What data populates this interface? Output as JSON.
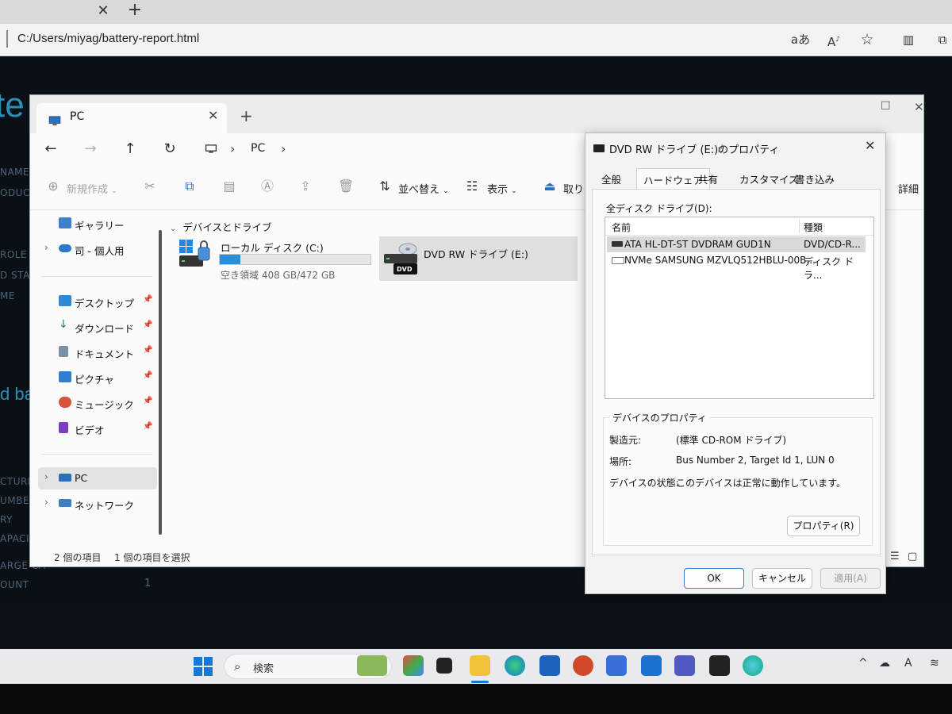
{
  "browser": {
    "address": "C:/Users/miyag/battery-report.html",
    "tools": [
      "aあ",
      "Aᴀ",
      "☆",
      "▥",
      "⧉"
    ]
  },
  "background_report": {
    "title_fragment": "te",
    "labels": [
      "NAME",
      "ODUCT",
      "ROLE",
      "D STAN",
      "ME"
    ],
    "heading_fragment": "d bat",
    "lower_labels": [
      "CTURER",
      "UMBER",
      "RY",
      "APACITY",
      "ARGE CA",
      "OUNT"
    ],
    "count_value": "1"
  },
  "explorer": {
    "tab_title": "PC",
    "address_crumb": "PC",
    "commands": {
      "new": "新規作成",
      "sort": "並べ替え",
      "view": "表示",
      "eject": "取り出",
      "details": "詳細"
    },
    "sidebar": {
      "gallery": "ギャラリー",
      "onedrive": "司 - 個人用",
      "desktop": "デスクトップ",
      "downloads": "ダウンロード",
      "documents": "ドキュメント",
      "pictures": "ピクチャ",
      "music": "ミュージック",
      "videos": "ビデオ",
      "pc": "PC",
      "network": "ネットワーク"
    },
    "section_title": "デバイスとドライブ",
    "drives": {
      "c_name": "ローカル ディスク (C:)",
      "c_space": "空き領域 408 GB/472 GB",
      "c_used_fraction": 0.136,
      "e_name": "DVD RW ドライブ (E:)",
      "e_badge": "DVD"
    },
    "status": {
      "items": "2 個の項目",
      "selected": "1 個の項目を選択"
    }
  },
  "dialog": {
    "title": "DVD RW ドライブ (E:)のプロパティ",
    "tabs": [
      "全般",
      "ハードウェア",
      "共有",
      "カスタマイズ",
      "書き込み"
    ],
    "active_tab": "ハードウェア",
    "list_label": "全ディスク ドライブ(D):",
    "columns": [
      "名前",
      "種類"
    ],
    "rows": [
      {
        "name": "ATA HL-DT-ST DVDRAM GUD1N",
        "type": "DVD/CD-R..."
      },
      {
        "name": "NVMe SAMSUNG MZVLQ512HBLU-00B...",
        "type": "ディスク ドラ..."
      }
    ],
    "group_title": "デバイスのプロパティ",
    "props": [
      {
        "key": "製造元:",
        "value": "(標準 CD-ROM ドライブ)"
      },
      {
        "key": "場所:",
        "value": "Bus Number 2, Target Id 1, LUN 0"
      },
      {
        "key": "デバイスの状態:",
        "value": "このデバイスは正常に動作しています。"
      }
    ],
    "properties_button": "プロパティ(R)",
    "ok": "OK",
    "cancel": "キャンセル",
    "apply": "適用(A)"
  },
  "taskbar": {
    "search_placeholder": "検索",
    "tray": [
      "^",
      "☁",
      "A",
      "≋"
    ]
  },
  "colors": {
    "accent": "#2c8fd6",
    "selection": "#dfdfdf",
    "background_page": "#0b1016"
  }
}
